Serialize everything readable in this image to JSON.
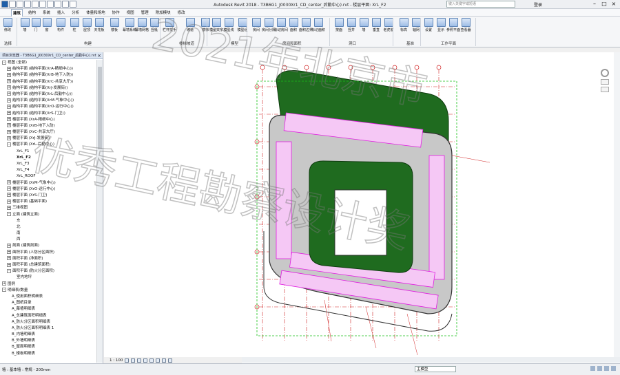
{
  "window": {
    "title": "Autodesk Revit 2018 -   T3B6G1_J0030Xr1_CD_center_后勤中心).rvt - 楼层平面: XrL_F2",
    "search_placeholder": "键入关键字或短语",
    "login": "登录"
  },
  "menu": {
    "tabs": [
      "建筑",
      "结构",
      "系统",
      "插入",
      "分析",
      "体量和场地",
      "协作",
      "视图",
      "管理",
      "附加模块",
      "修改"
    ],
    "active_tab": "建筑"
  },
  "ribbon": {
    "buttons": [
      "修改",
      "墙",
      "门",
      "窗",
      "构件",
      "柱",
      "屋顶",
      "天花板",
      "楼板",
      "幕墙系统",
      "幕墙网格",
      "竖梃",
      "栏杆扶手",
      "坡道",
      "楼梯",
      "模型文字",
      "模型线",
      "模型组",
      "房间",
      "房间分隔",
      "标记房间",
      "面积",
      "面积边界",
      "标记面积",
      "按面",
      "竖井",
      "墙",
      "垂直",
      "老虎窗",
      "标高",
      "轴网",
      "设置",
      "显示",
      "参照平面",
      "查看器"
    ],
    "groups": [
      "选择",
      "构建",
      "楼梯坡道",
      "模型",
      "房间和面积",
      "洞口",
      "基准",
      "工作平面"
    ]
  },
  "browser": {
    "title": "项目浏览器 - T3B6G1_J0030Xr1_CD_center_后勤中心).rvt",
    "tree": [
      {
        "label": "视图 (全部)",
        "level": 0,
        "exp": "-"
      },
      {
        "label": "结构平面 (结构平面(XrA-精细中心))",
        "level": 1,
        "exp": "+"
      },
      {
        "label": "结构平面 (结构平面(XrB-地下入防))",
        "level": 1,
        "exp": "+"
      },
      {
        "label": "结构平面 (结构平面(XrC-共享大厅))",
        "level": 1,
        "exp": "+"
      },
      {
        "label": "结构平面 (结构平面(XrJ-发展街))",
        "level": 1,
        "exp": "+"
      },
      {
        "label": "结构平面 (结构平面(XrL-后勤中心))",
        "level": 1,
        "exp": "+"
      },
      {
        "label": "结构平面 (结构平面(XrM-气象中心))",
        "level": 1,
        "exp": "+"
      },
      {
        "label": "结构平面 (结构平面(XrO-运行中心))",
        "level": 1,
        "exp": "+"
      },
      {
        "label": "结构平面 (结构平面(XrS-门卫))",
        "level": 1,
        "exp": "+"
      },
      {
        "label": "楼层平面 (XrA-精细中心)",
        "level": 1,
        "exp": "+"
      },
      {
        "label": "楼层平面 (XrB-地下入防)",
        "level": 1,
        "exp": "+"
      },
      {
        "label": "楼层平面 (XrC-共享大厅)",
        "level": 1,
        "exp": "+"
      },
      {
        "label": "楼层平面 (XrJ-发展街)",
        "level": 1,
        "exp": "+"
      },
      {
        "label": "楼层平面 (XrL-后勤中心)",
        "level": 1,
        "exp": "-"
      },
      {
        "label": "XrL_F1",
        "level": 3,
        "exp": ""
      },
      {
        "label": "XrL_F2",
        "level": 3,
        "exp": "",
        "sel": true
      },
      {
        "label": "XrL_F3",
        "level": 3,
        "exp": ""
      },
      {
        "label": "XrL_F4",
        "level": 3,
        "exp": ""
      },
      {
        "label": "XrL_ROOF",
        "level": 3,
        "exp": ""
      },
      {
        "label": "楼层平面 (XrM-气象中心)",
        "level": 1,
        "exp": "+"
      },
      {
        "label": "楼层平面 (XrO-运行中心)",
        "level": 1,
        "exp": "+"
      },
      {
        "label": "楼层平面 (XrS-门卫)",
        "level": 1,
        "exp": "+"
      },
      {
        "label": "楼层平面 (基础平面)",
        "level": 1,
        "exp": "+"
      },
      {
        "label": "三维视图",
        "level": 1,
        "exp": "+"
      },
      {
        "label": "立面 (建筑立面)",
        "level": 1,
        "exp": "-"
      },
      {
        "label": "东",
        "level": 3,
        "exp": ""
      },
      {
        "label": "北",
        "level": 3,
        "exp": ""
      },
      {
        "label": "南",
        "level": 3,
        "exp": ""
      },
      {
        "label": "西",
        "level": 3,
        "exp": ""
      },
      {
        "label": "剖面 (建筑剖面)",
        "level": 1,
        "exp": "+"
      },
      {
        "label": "面积平面 (人防分区面积)",
        "level": 1,
        "exp": "+"
      },
      {
        "label": "面积平面 (净面积)",
        "level": 1,
        "exp": "+"
      },
      {
        "label": "面积平面 (总建筑面积)",
        "level": 1,
        "exp": "+"
      },
      {
        "label": "面积平面 (防火分区面积)",
        "level": 1,
        "exp": "-"
      },
      {
        "label": "室内地坪",
        "level": 3,
        "exp": ""
      },
      {
        "label": "图例",
        "level": 0,
        "exp": "+"
      },
      {
        "label": "明细表/数量",
        "level": 0,
        "exp": "-"
      },
      {
        "label": "A_使用面积明细表",
        "level": 2,
        "exp": ""
      },
      {
        "label": "A_图纸目录",
        "level": 2,
        "exp": ""
      },
      {
        "label": "A_幕墙明细表",
        "level": 2,
        "exp": ""
      },
      {
        "label": "A_总建筑面积明细表",
        "level": 2,
        "exp": ""
      },
      {
        "label": "A_防火分区面积明细表",
        "level": 2,
        "exp": ""
      },
      {
        "label": "A_防火分区面积明细表 1",
        "level": 2,
        "exp": ""
      },
      {
        "label": "B_内墙明细表",
        "level": 2,
        "exp": ""
      },
      {
        "label": "B_外墙明细表",
        "level": 2,
        "exp": ""
      },
      {
        "label": "B_屋面明细表",
        "level": 2,
        "exp": ""
      },
      {
        "label": "B_楼板明细表",
        "level": 2,
        "exp": ""
      }
    ]
  },
  "view": {
    "scale": "1 : 100"
  },
  "status": {
    "text": "墙 : 基本墙 : 常规 - 200mm",
    "model": "主模型"
  },
  "watermark": {
    "line1": "2021年北京市",
    "line2": "优秀工程勘察设计奖"
  },
  "colors": {
    "green": "#1f6b1f",
    "magenta": "#e020e0",
    "grid_red": "#d02020",
    "gray_floor": "#c8c8c8"
  }
}
